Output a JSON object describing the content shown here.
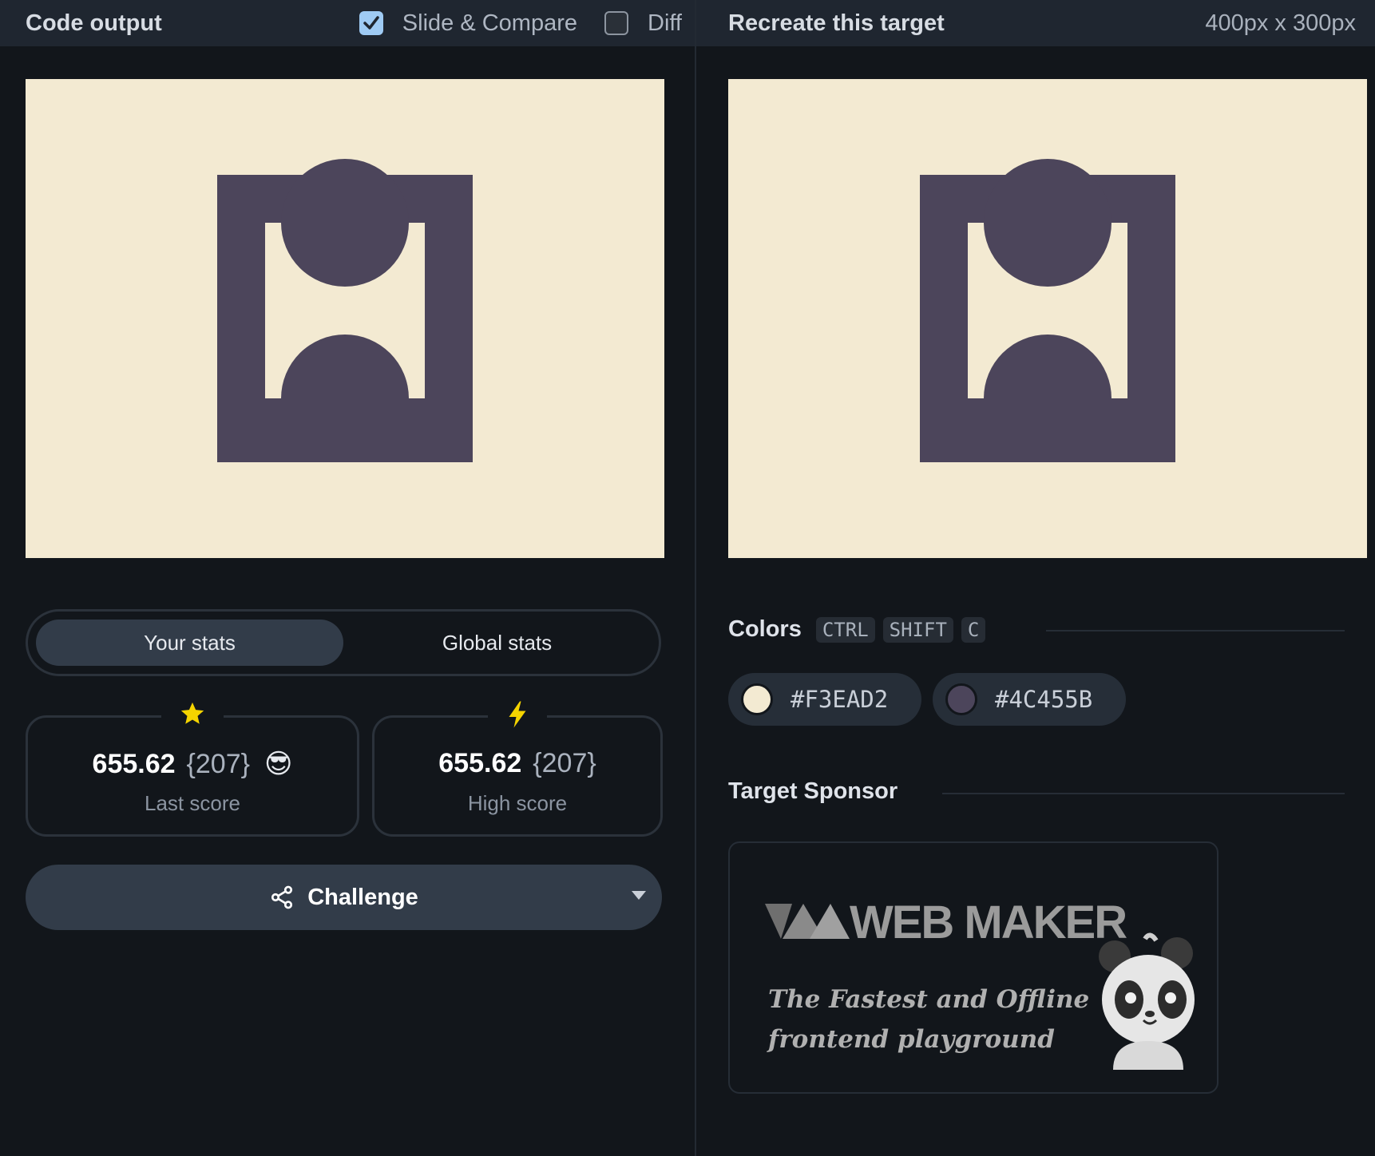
{
  "left_panel": {
    "title": "Code output",
    "slide_compare": {
      "label": "Slide & Compare",
      "checked": true
    },
    "diff": {
      "label": "Diff",
      "checked": false
    },
    "tabs": [
      {
        "label": "Your stats",
        "active": true
      },
      {
        "label": "Global stats",
        "active": false
      }
    ],
    "last_score": {
      "score": "655.62",
      "count": "{207}",
      "emoji": "😎",
      "label": "Last score",
      "icon": "star-icon"
    },
    "high_score": {
      "score": "655.62",
      "count": "{207}",
      "label": "High score",
      "icon": "lightning-icon"
    },
    "challenge_label": "Challenge"
  },
  "right_panel": {
    "title": "Recreate this target",
    "dimensions": "400px x 300px",
    "colors_heading": "Colors",
    "shortcut_keys": [
      "CTRL",
      "SHIFT",
      "C"
    ],
    "colors": [
      {
        "hex": "#F3EAD2"
      },
      {
        "hex": "#4C455B"
      }
    ],
    "sponsor_heading": "Target Sponsor",
    "sponsor": {
      "brand": "WEB MAKER",
      "tagline_line1": "The Fastest and Offline",
      "tagline_line2": "frontend playground"
    }
  },
  "palette": {
    "background": "#F3EAD2",
    "shape": "#4C455B",
    "accent_check": "#9fcbf4",
    "star": "#f5d400"
  }
}
